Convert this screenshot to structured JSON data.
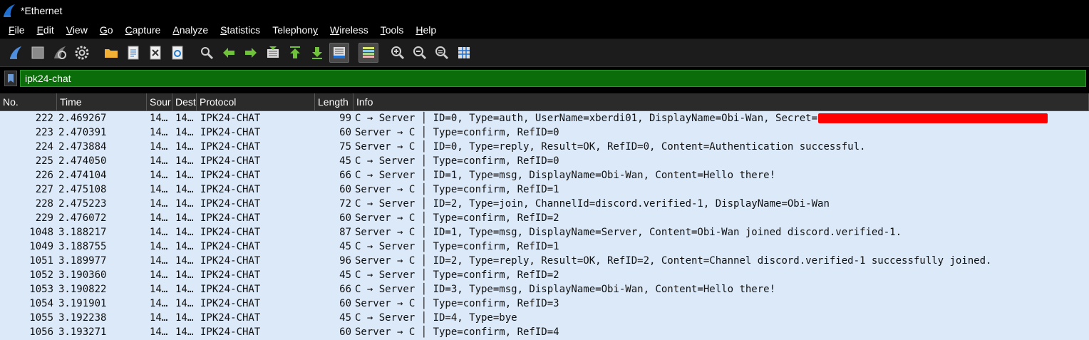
{
  "window": {
    "title": "*Ethernet"
  },
  "menu": [
    {
      "key": "F",
      "rest": "ile"
    },
    {
      "key": "E",
      "rest": "dit"
    },
    {
      "key": "V",
      "rest": "iew"
    },
    {
      "key": "G",
      "rest": "o"
    },
    {
      "key": "C",
      "rest": "apture"
    },
    {
      "key": "A",
      "rest": "nalyze"
    },
    {
      "key": "S",
      "rest": "tatistics"
    },
    {
      "key": "",
      "rest": "Telephony",
      "under": "y"
    },
    {
      "key": "W",
      "rest": "ireless"
    },
    {
      "key": "T",
      "rest": "ools"
    },
    {
      "key": "H",
      "rest": "elp"
    }
  ],
  "toolbar": {
    "icons": [
      "shark-fin-icon",
      "stop-icon",
      "restart-icon",
      "options-gear-icon",
      "open-folder-icon",
      "file-icon",
      "close-file-icon",
      "reload-icon",
      "find-icon",
      "back-arrow-icon",
      "forward-arrow-icon",
      "go-to-packet-icon",
      "first-packet-icon",
      "last-packet-icon",
      "autoscroll-icon",
      "colorize-icon",
      "zoom-in-icon",
      "zoom-out-icon",
      "normal-size-icon",
      "resize-columns-icon"
    ]
  },
  "filter": {
    "value": "ipk24-chat"
  },
  "columns": [
    "No.",
    "Time",
    "Sour",
    "Dest",
    "Protocol",
    "Length",
    "Info"
  ],
  "rows": [
    {
      "no": "222",
      "time": "2.469267",
      "src": "14…",
      "dst": "14…",
      "proto": "IPK24-CHAT",
      "len": "99",
      "info": "C → Server │ ID=0, Type=auth, UserName=xberdi01, DisplayName=Obi-Wan, Secret=",
      "redacted": true
    },
    {
      "no": "223",
      "time": "2.470391",
      "src": "14…",
      "dst": "14…",
      "proto": "IPK24-CHAT",
      "len": "60",
      "info": "Server → C │ Type=confirm, RefID=0"
    },
    {
      "no": "224",
      "time": "2.473884",
      "src": "14…",
      "dst": "14…",
      "proto": "IPK24-CHAT",
      "len": "75",
      "info": "Server → C │ ID=0, Type=reply, Result=OK, RefID=0, Content=Authentication successful."
    },
    {
      "no": "225",
      "time": "2.474050",
      "src": "14…",
      "dst": "14…",
      "proto": "IPK24-CHAT",
      "len": "45",
      "info": "C → Server │ Type=confirm, RefID=0"
    },
    {
      "no": "226",
      "time": "2.474104",
      "src": "14…",
      "dst": "14…",
      "proto": "IPK24-CHAT",
      "len": "66",
      "info": "C → Server │ ID=1, Type=msg, DisplayName=Obi-Wan, Content=Hello there!"
    },
    {
      "no": "227",
      "time": "2.475108",
      "src": "14…",
      "dst": "14…",
      "proto": "IPK24-CHAT",
      "len": "60",
      "info": "Server → C │ Type=confirm, RefID=1"
    },
    {
      "no": "228",
      "time": "2.475223",
      "src": "14…",
      "dst": "14…",
      "proto": "IPK24-CHAT",
      "len": "72",
      "info": "C → Server │ ID=2, Type=join, ChannelId=discord.verified-1, DisplayName=Obi-Wan"
    },
    {
      "no": "229",
      "time": "2.476072",
      "src": "14…",
      "dst": "14…",
      "proto": "IPK24-CHAT",
      "len": "60",
      "info": "Server → C │ Type=confirm, RefID=2"
    },
    {
      "no": "1048",
      "time": "3.188217",
      "src": "14…",
      "dst": "14…",
      "proto": "IPK24-CHAT",
      "len": "87",
      "info": "Server → C │ ID=1, Type=msg, DisplayName=Server, Content=Obi-Wan joined discord.verified-1."
    },
    {
      "no": "1049",
      "time": "3.188755",
      "src": "14…",
      "dst": "14…",
      "proto": "IPK24-CHAT",
      "len": "45",
      "info": "C → Server │ Type=confirm, RefID=1"
    },
    {
      "no": "1051",
      "time": "3.189977",
      "src": "14…",
      "dst": "14…",
      "proto": "IPK24-CHAT",
      "len": "96",
      "info": "Server → C │ ID=2, Type=reply, Result=OK, RefID=2, Content=Channel discord.verified-1 successfully joined."
    },
    {
      "no": "1052",
      "time": "3.190360",
      "src": "14…",
      "dst": "14…",
      "proto": "IPK24-CHAT",
      "len": "45",
      "info": "C → Server │ Type=confirm, RefID=2"
    },
    {
      "no": "1053",
      "time": "3.190822",
      "src": "14…",
      "dst": "14…",
      "proto": "IPK24-CHAT",
      "len": "66",
      "info": "C → Server │ ID=3, Type=msg, DisplayName=Obi-Wan, Content=Hello there!"
    },
    {
      "no": "1054",
      "time": "3.191901",
      "src": "14…",
      "dst": "14…",
      "proto": "IPK24-CHAT",
      "len": "60",
      "info": "Server → C │ Type=confirm, RefID=3"
    },
    {
      "no": "1055",
      "time": "3.192238",
      "src": "14…",
      "dst": "14…",
      "proto": "IPK24-CHAT",
      "len": "45",
      "info": "C → Server │ ID=4, Type=bye"
    },
    {
      "no": "1056",
      "time": "3.193271",
      "src": "14…",
      "dst": "14…",
      "proto": "IPK24-CHAT",
      "len": "60",
      "info": "Server → C │ Type=confirm, RefID=4"
    }
  ],
  "colors": {
    "row_bg": "#dbe9f9",
    "filter_valid": "#0a6d0a",
    "redaction": "#ff0000"
  }
}
